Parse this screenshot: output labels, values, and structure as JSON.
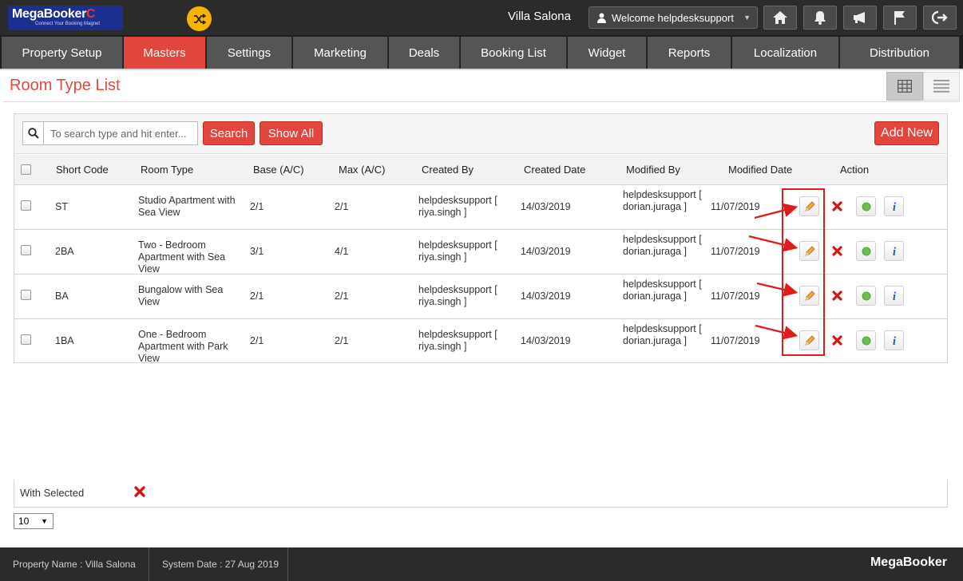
{
  "header": {
    "logo_text": "MegaBooker",
    "logo_tagline": "Connect Your Booking Magnet",
    "property_name": "Villa Salona",
    "welcome_text": "Welcome helpdesksupport",
    "icons": [
      "home-icon",
      "bell-icon",
      "megaphone-icon",
      "flag-icon",
      "logout-icon"
    ]
  },
  "nav": {
    "items": [
      "Property Setup",
      "Masters",
      "Settings",
      "Marketing",
      "Deals",
      "Booking List",
      "Widget",
      "Reports",
      "Localization",
      "Distribution"
    ],
    "active": "Masters"
  },
  "page": {
    "title": "Room Type List"
  },
  "toolbar": {
    "search_placeholder": "To search type and hit enter...",
    "search_label": "Search",
    "show_all_label": "Show All",
    "add_new_label": "Add New"
  },
  "table": {
    "headers": [
      "Short Code",
      "Room Type",
      "Base (A/C)",
      "Max (A/C)",
      "Created By",
      "Created Date",
      "Modified By",
      "Modified Date",
      "Action"
    ],
    "rows": [
      {
        "code": "ST",
        "type": "Studio Apartment with Sea View",
        "base": "2/1",
        "max": "2/1",
        "created_by": "helpdesksupport [ riya.singh ]",
        "created_date": "14/03/2019",
        "modified_by": "helpdesksupport [ dorian.juraga ]",
        "modified_date": "11/07/2019"
      },
      {
        "code": "2BA",
        "type": "Two - Bedroom Apartment with Sea View",
        "base": "3/1",
        "max": "4/1",
        "created_by": "helpdesksupport [ riya.singh ]",
        "created_date": "14/03/2019",
        "modified_by": "helpdesksupport [ dorian.juraga ]",
        "modified_date": "11/07/2019"
      },
      {
        "code": "BA",
        "type": "Bungalow with Sea View",
        "base": "2/1",
        "max": "2/1",
        "created_by": "helpdesksupport [ riya.singh ]",
        "created_date": "14/03/2019",
        "modified_by": "helpdesksupport [ dorian.juraga ]",
        "modified_date": "11/07/2019"
      },
      {
        "code": "1BA",
        "type": "One - Bedroom Apartment with Park View",
        "base": "2/1",
        "max": "2/1",
        "created_by": "helpdesksupport [ riya.singh ]",
        "created_date": "14/03/2019",
        "modified_by": "helpdesksupport [ dorian.juraga ]",
        "modified_date": "11/07/2019"
      }
    ]
  },
  "bulk": {
    "with_selected_label": "With Selected"
  },
  "pagination": {
    "page_size": "10"
  },
  "footer": {
    "property": "Property Name : Villa Salona",
    "system_date": "System Date : 27 Aug 2019",
    "brand": "MegaBooker"
  },
  "colors": {
    "accent": "#e2463d",
    "annotation": "#e01b1b"
  }
}
